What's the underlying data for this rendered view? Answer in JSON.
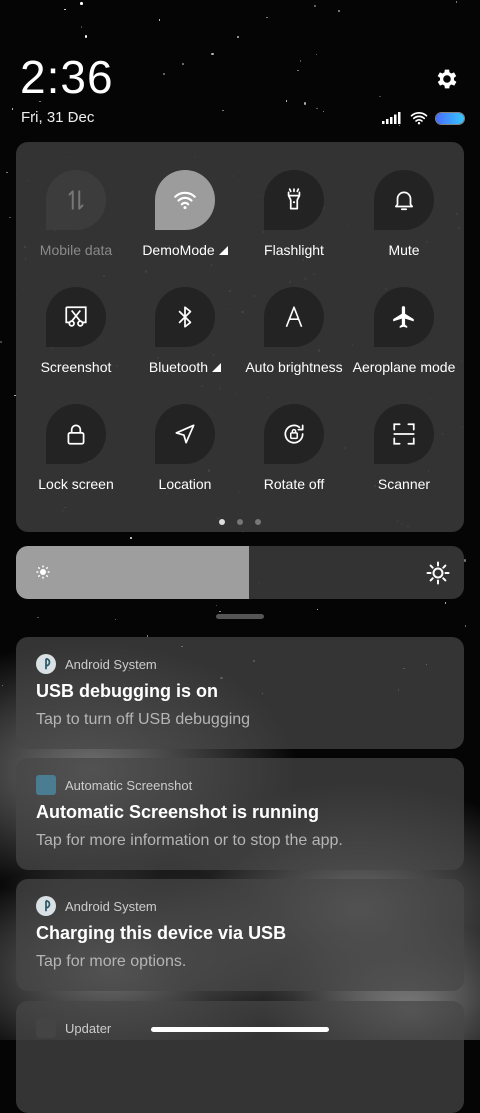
{
  "status": {
    "time": "2:36",
    "date": "Fri, 31 Dec",
    "battery_color": "#4a6dff"
  },
  "quick_settings": {
    "tiles": [
      {
        "label": "Mobile data",
        "icon": "mobile-data-icon",
        "state": "disabled"
      },
      {
        "label": "DemoMode",
        "icon": "wifi-icon",
        "state": "active"
      },
      {
        "label": "Flashlight",
        "icon": "flashlight-icon",
        "state": "off"
      },
      {
        "label": "Mute",
        "icon": "bell-icon",
        "state": "off"
      },
      {
        "label": "Screenshot",
        "icon": "screenshot-icon",
        "state": "off"
      },
      {
        "label": "Bluetooth",
        "icon": "bluetooth-icon",
        "state": "off"
      },
      {
        "label": "Auto brightness",
        "icon": "auto-brightness-icon",
        "state": "off"
      },
      {
        "label": "Aeroplane mode",
        "icon": "airplane-icon",
        "state": "off"
      },
      {
        "label": "Lock screen",
        "icon": "lock-icon",
        "state": "off"
      },
      {
        "label": "Location",
        "icon": "location-icon",
        "state": "off"
      },
      {
        "label": "Rotate off",
        "icon": "rotate-lock-icon",
        "state": "off"
      },
      {
        "label": "Scanner",
        "icon": "scanner-icon",
        "state": "off"
      }
    ],
    "page_count": 3,
    "current_page": 1
  },
  "brightness": {
    "level": 0.52
  },
  "notifications": [
    {
      "app": "Android System",
      "title": "USB debugging is on",
      "body": "Tap to turn off USB debugging",
      "icon": "android-system-icon"
    },
    {
      "app": "Automatic Screenshot",
      "title": "Automatic Screenshot is running",
      "body": "Tap for more information or to stop the app.",
      "icon": "screenshot-app-icon"
    },
    {
      "app": "Android System",
      "title": "Charging this device via USB",
      "body": "Tap for more options.",
      "icon": "android-system-icon"
    },
    {
      "app": "Updater",
      "title": "",
      "body": "",
      "icon": "updater-icon"
    }
  ]
}
